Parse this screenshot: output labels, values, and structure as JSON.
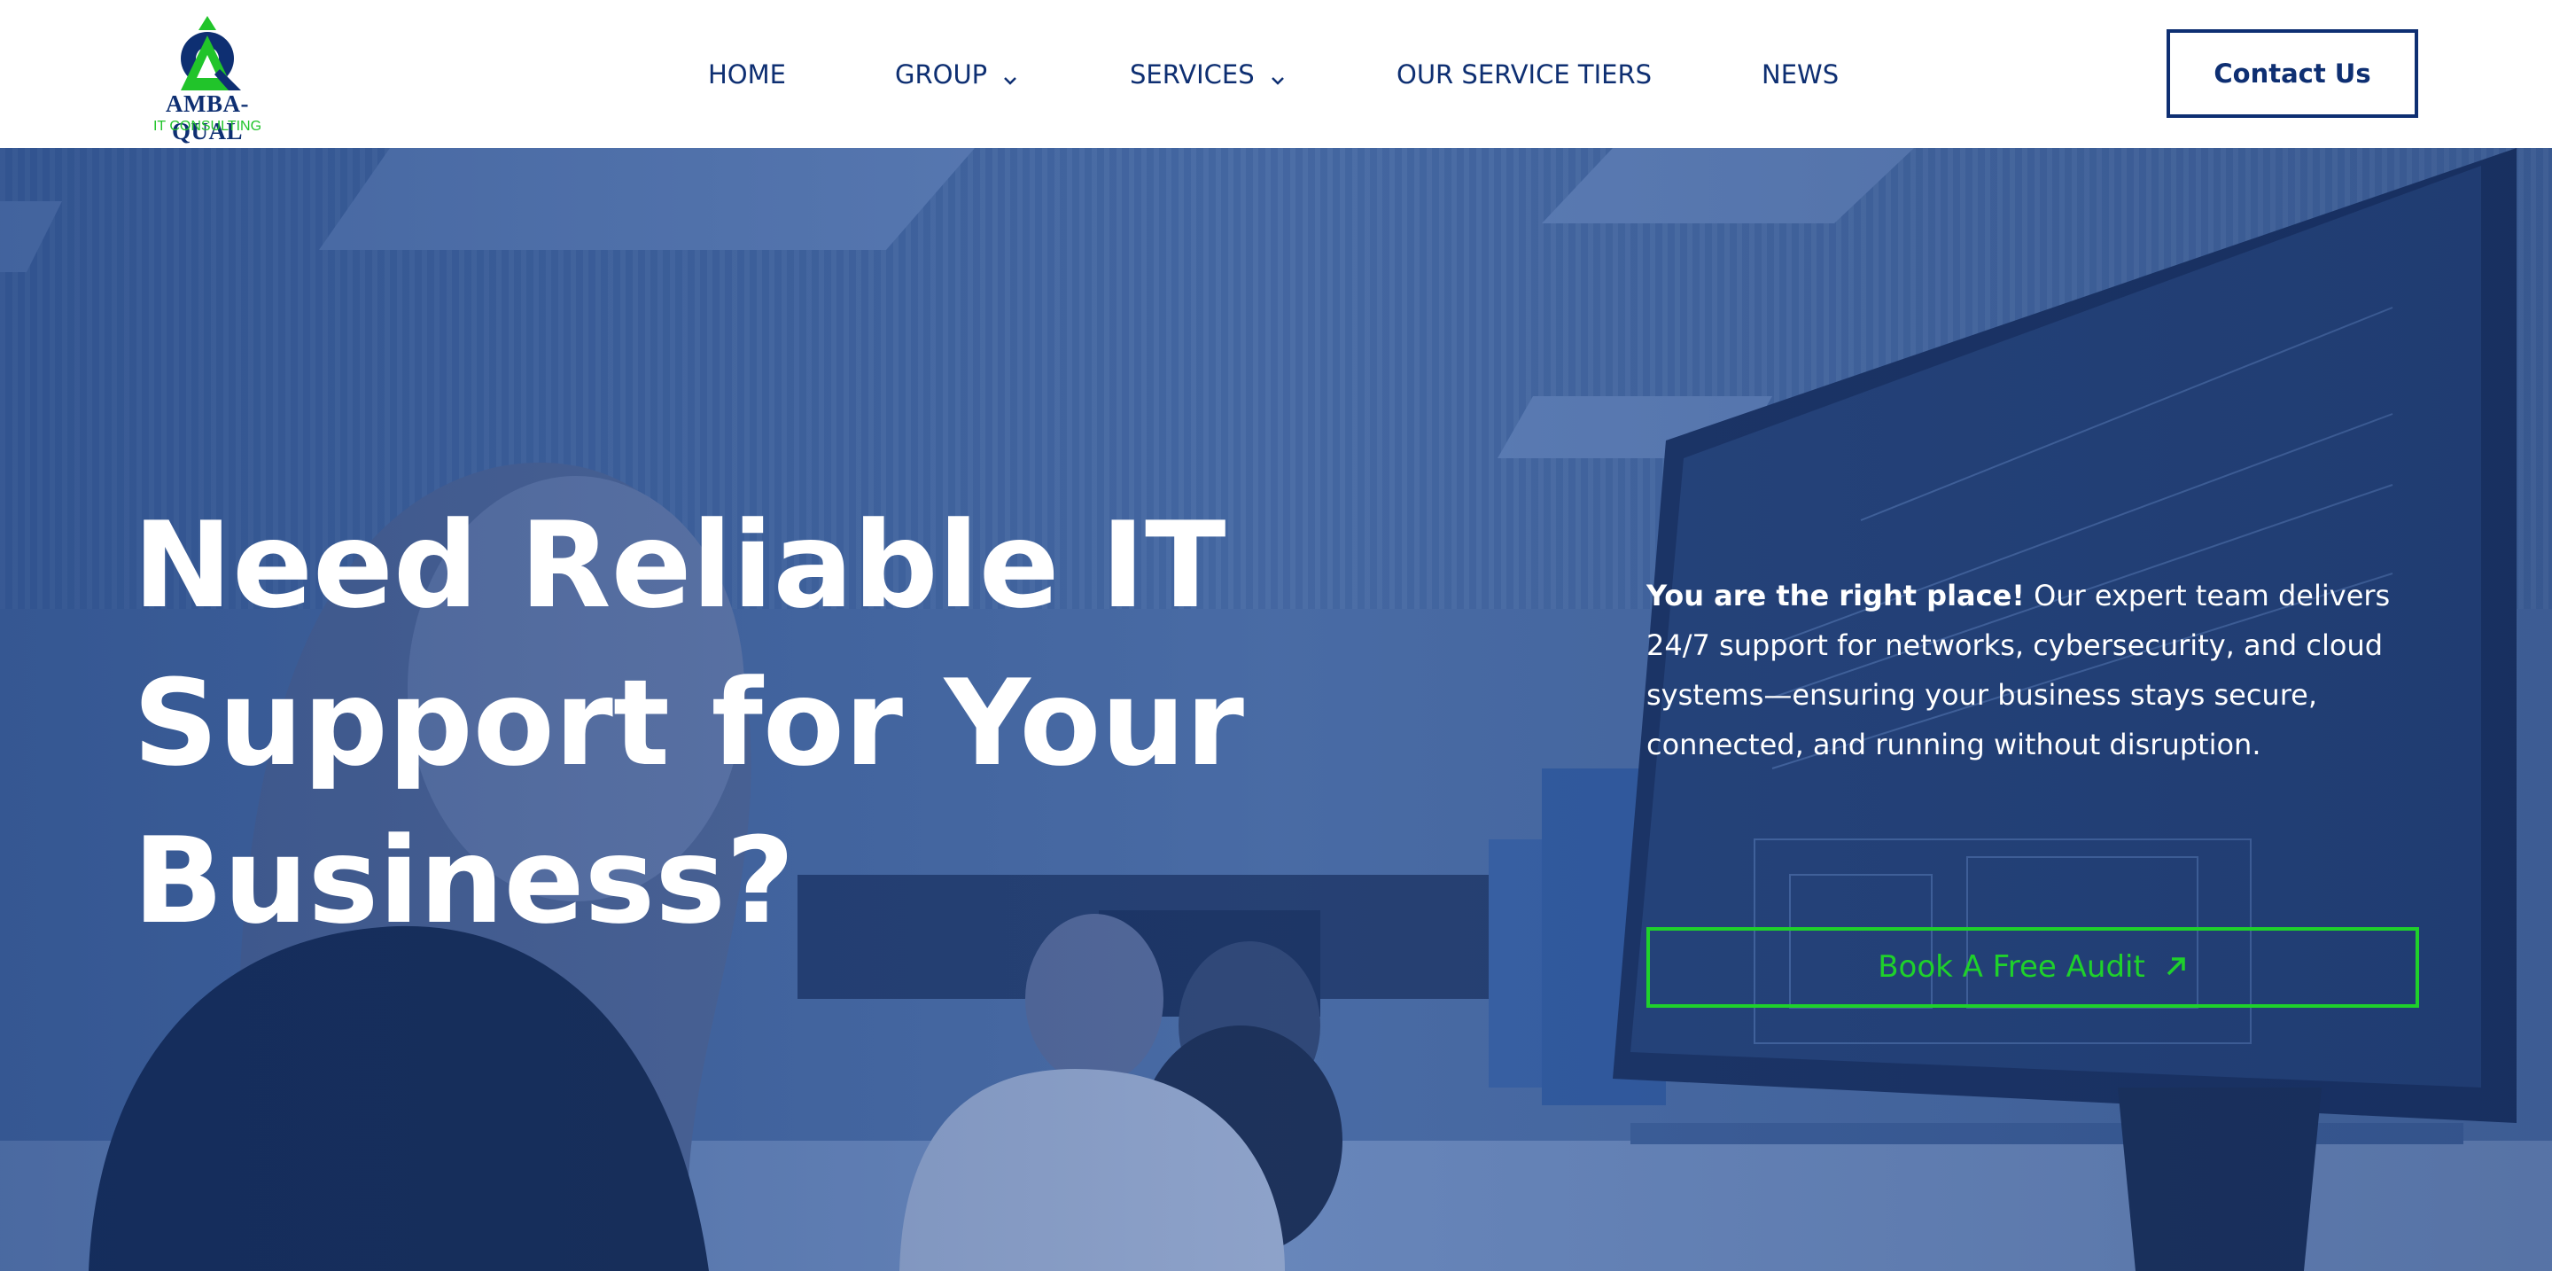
{
  "brand": {
    "name": "AMBA-QUAL",
    "tagline": "IT CONSULTING",
    "primary_color": "#0e2f72",
    "accent_color": "#21c42a"
  },
  "nav": {
    "items": [
      {
        "label": "HOME",
        "has_dropdown": false
      },
      {
        "label": "GROUP",
        "has_dropdown": true
      },
      {
        "label": "SERVICES",
        "has_dropdown": true
      },
      {
        "label": "OUR SERVICE TIERS",
        "has_dropdown": false
      },
      {
        "label": "NEWS",
        "has_dropdown": false
      }
    ],
    "contact_label": "Contact Us"
  },
  "hero": {
    "headline_lines": [
      "Need Reliable IT",
      "Support for Your",
      "Business?"
    ],
    "lead_bold": "You are the right place!",
    "lead_text": " Our expert team delivers 24/7 support for networks, cybersecurity, and cloud systems—ensuring your business stays secure, connected, and running without disruption.",
    "cta_label": "Book A Free Audit",
    "cta_icon": "arrow-up-right-icon",
    "background": "office-workers-at-computers-photo"
  }
}
